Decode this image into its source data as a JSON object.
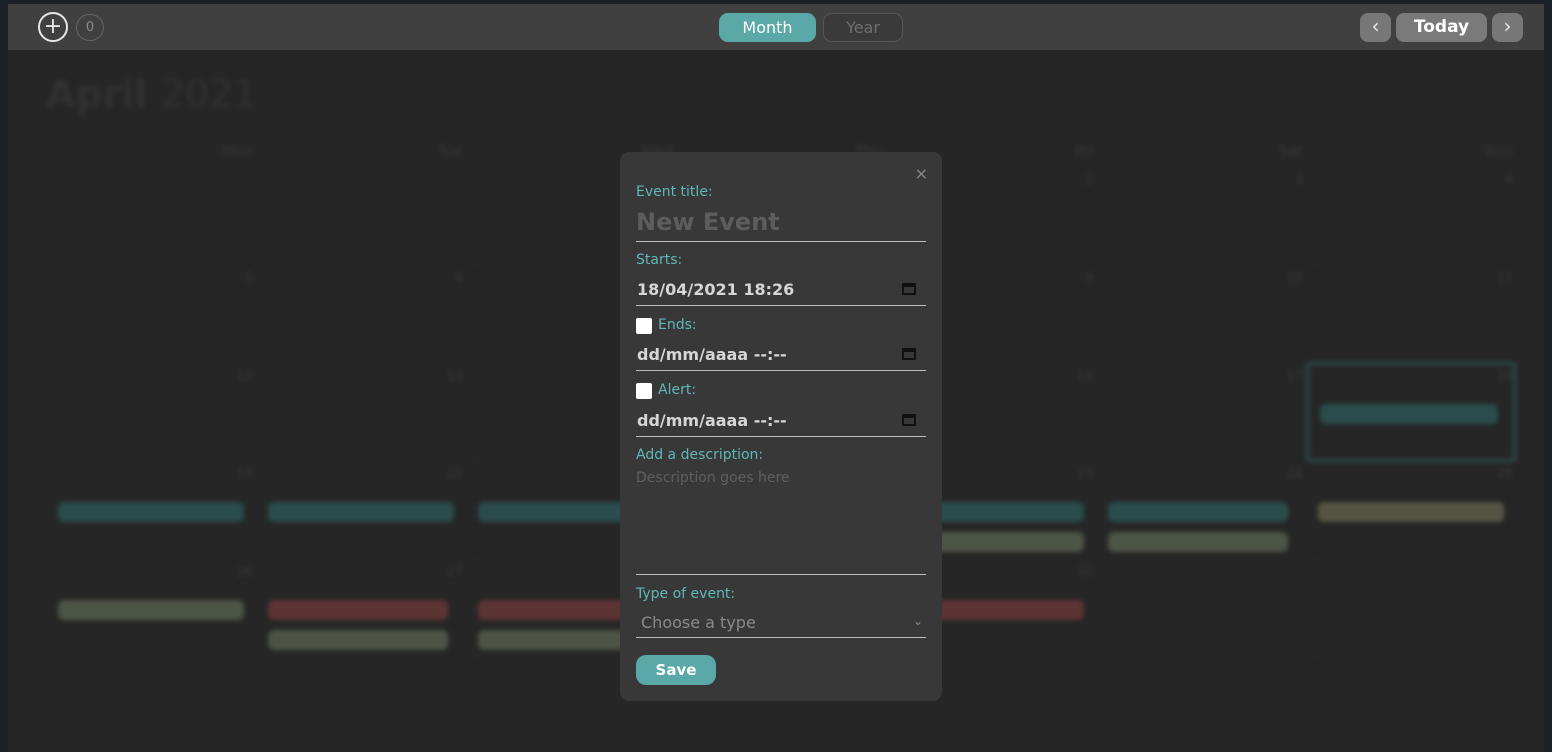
{
  "toolbar": {
    "add_label": "+",
    "event_count": "0",
    "views": [
      "Month",
      "Year"
    ],
    "active_view": "Month",
    "prev_glyph": "‹",
    "next_glyph": "›",
    "today_label": "Today"
  },
  "calendar": {
    "month": "April",
    "year": "2021",
    "weekdays": [
      "Mon",
      "Tue",
      "Wed",
      "Thu",
      "Fri",
      "Sat",
      "Sun"
    ]
  },
  "modal": {
    "close_glyph": "×",
    "event_title_label": "Event title:",
    "event_title_placeholder": "New Event",
    "starts_label": "Starts:",
    "starts_value": "18/04/2021 18:26",
    "ends_label": "Ends:",
    "ends_value": "dd/mm/aaaa --:--",
    "alert_label": "Alert:",
    "alert_value": "dd/mm/aaaa --:--",
    "description_label": "Add a description:",
    "description_placeholder": "Description goes here",
    "type_label": "Type of event:",
    "type_placeholder": "Choose a type",
    "save_label": "Save"
  },
  "colors": {
    "accent": "#5aa8a8",
    "modal_bg": "#383838",
    "topbar_bg": "#404040"
  }
}
